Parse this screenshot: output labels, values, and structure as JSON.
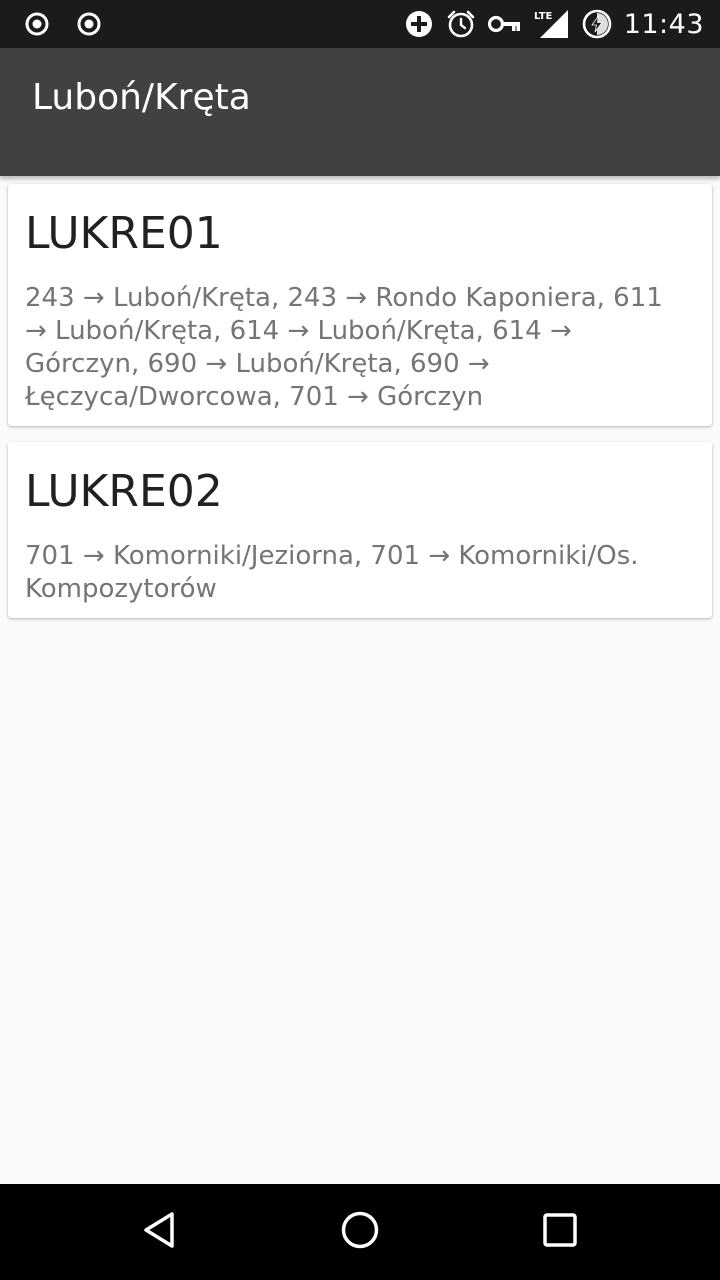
{
  "status_bar": {
    "time": "11:43",
    "network": "LTE",
    "left_icons": [
      "record-icon",
      "record-icon"
    ],
    "right_icons": [
      "add-circle-icon",
      "alarm-icon",
      "vpn-key-icon",
      "lte-signal-icon",
      "battery-charging-icon"
    ]
  },
  "app_bar": {
    "title": "Luboń/Kręta"
  },
  "stops": [
    {
      "code": "LUKRE01",
      "routes": "243 → Luboń/Kręta, 243 → Rondo Kaponiera, 611 → Luboń/Kręta, 614 → Luboń/Kręta, 614 → Górczyn, 690 → Luboń/Kręta, 690 → Łęczyca/Dworcowa, 701 → Górczyn"
    },
    {
      "code": "LUKRE02",
      "routes": "701 → Komorniki/Jeziorna, 701 → Komorniki/Os. Kompozytorów"
    }
  ],
  "nav_bar": {
    "buttons": [
      "back-icon",
      "home-icon",
      "recents-icon"
    ]
  },
  "colors": {
    "status_bar": "#1b1b1b",
    "app_bar": "#414141",
    "background": "#fafafa",
    "card": "#ffffff",
    "title_text": "#212121",
    "secondary_text": "#757575",
    "nav_bar": "#000000"
  }
}
